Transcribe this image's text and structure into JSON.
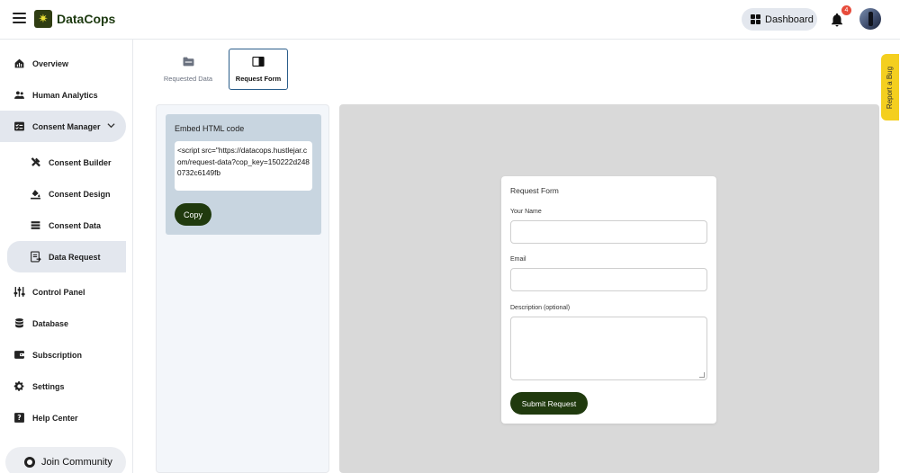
{
  "app": {
    "name": "DataCops"
  },
  "header": {
    "dashboard_label": "Dashboard",
    "notification_count": "4"
  },
  "sidebar": {
    "items": [
      {
        "label": "Overview",
        "icon": "home-chart-icon"
      },
      {
        "label": "Human Analytics",
        "icon": "people-icon"
      },
      {
        "label": "Consent Manager",
        "icon": "checklist-icon"
      },
      {
        "label": "Consent Builder",
        "icon": "tools-icon"
      },
      {
        "label": "Consent Design",
        "icon": "paint-bucket-icon"
      },
      {
        "label": "Consent Data",
        "icon": "list-icon"
      },
      {
        "label": "Data Request",
        "icon": "data-request-icon"
      },
      {
        "label": "Control Panel",
        "icon": "sliders-icon"
      },
      {
        "label": "Database",
        "icon": "database-icon"
      },
      {
        "label": "Subscription",
        "icon": "wallet-icon"
      },
      {
        "label": "Settings",
        "icon": "gear-icon"
      },
      {
        "label": "Help Center",
        "icon": "help-icon"
      }
    ],
    "join_label": "Join Community"
  },
  "tabs": [
    {
      "label": "Requested Data",
      "icon": "folder-icon"
    },
    {
      "label": "Request Form",
      "icon": "form-icon"
    }
  ],
  "embed": {
    "title": "Embed HTML code",
    "code": "<script src=\"https://datacops.hustlejar.com/request-data?cop_key=150222d2480732c6149fb",
    "copy_label": "Copy"
  },
  "form": {
    "title": "Request Form",
    "name_label": "Your Name",
    "email_label": "Email",
    "description_label": "Description (optional)",
    "submit_label": "Submit Request"
  },
  "bug_label": "Report a Bug",
  "colors": {
    "primary": "#203a0e",
    "accent_yellow": "#f4cf1f",
    "nav_highlight": "#e3e7ee",
    "badge_red": "#e74c3c"
  }
}
